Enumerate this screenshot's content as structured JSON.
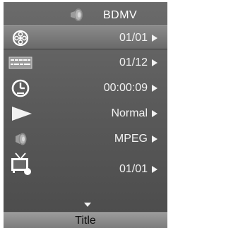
{
  "header": {
    "title": "BDMV",
    "icon": "speaker-icon"
  },
  "menu": {
    "rows": [
      {
        "icon": "film-reel-icon",
        "value": "01/01",
        "selected": true
      },
      {
        "icon": "subtitle-icon",
        "value": "01/12",
        "selected": false
      },
      {
        "icon": "clock-icon",
        "value": "00:00:09",
        "selected": false
      },
      {
        "icon": "play-icon",
        "value": "Normal",
        "selected": false
      },
      {
        "icon": "speaker-icon",
        "value": "MPEG",
        "selected": false
      },
      {
        "icon": "tv-icon",
        "value": "01/01",
        "selected": false
      }
    ]
  },
  "footer": {
    "label": "Title"
  },
  "colors": {
    "background": "#5a5a5a",
    "selected_row": "#7a7a7a",
    "text": "#f2f2f2",
    "footer_text": "#111111"
  }
}
